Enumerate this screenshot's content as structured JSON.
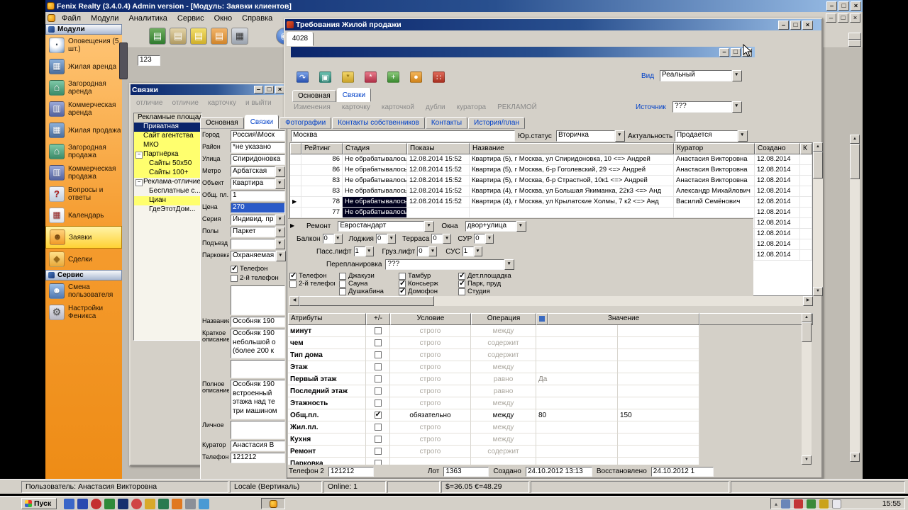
{
  "titlebar": {
    "title": "Fenix Realty (3.4.0.4) Admin version - [Модуль: Заявки клиентов]"
  },
  "menu": {
    "items": [
      "Файл",
      "Модули",
      "Аналитика",
      "Сервис",
      "Окно",
      "Справка"
    ]
  },
  "toolbar": {
    "field_value": "123"
  },
  "sidebar": {
    "modules_header": "Модули",
    "service_header": "Сервис",
    "module_items": [
      {
        "label": "Оповещения (5 шт.)",
        "icon": "clock"
      },
      {
        "label": "Жилая аренда",
        "icon": "building"
      },
      {
        "label": "Загородная аренда",
        "icon": "house"
      },
      {
        "label": "Коммерческая аренда",
        "icon": "tower"
      },
      {
        "label": "Жилая продажа",
        "icon": "building"
      },
      {
        "label": "Загородная продажа",
        "icon": "house"
      },
      {
        "label": "Коммерческая продажа",
        "icon": "tower"
      },
      {
        "label": "Вопросы и ответы",
        "icon": "question"
      },
      {
        "label": "Календарь",
        "icon": "calendar"
      },
      {
        "label": "Заявки",
        "icon": "people",
        "cls": "sel"
      },
      {
        "label": "Сделки",
        "icon": "deal"
      }
    ],
    "service_items": [
      {
        "label": "Смена пользователя",
        "icon": "user"
      },
      {
        "label": "Настройки Феникса",
        "icon": "gear"
      }
    ]
  },
  "svyazki": {
    "title": "Связки",
    "toolbar_labels": [
      "отличие",
      "отличие",
      "карточку",
      "и выйти"
    ],
    "tree_items": [
      {
        "label": "Рекламные площадки",
        "cls": "hdr"
      },
      {
        "label": "Приватная",
        "cls": "sel lvl1"
      },
      {
        "label": "Сайт агентства",
        "cls": "yel lvl1"
      },
      {
        "label": "МКО",
        "cls": "yel lvl1"
      },
      {
        "label": "Партнёрка",
        "cls": "yel lvl1 exp"
      },
      {
        "label": "Сайты 50х50",
        "cls": "yel lvl2"
      },
      {
        "label": "Сайты 100+",
        "cls": "yel lvl2"
      },
      {
        "label": "Реклама-отличие",
        "cls": "lvl1 exp"
      },
      {
        "label": "Бесплатные с...",
        "cls": "lvl2"
      },
      {
        "label": "Циан",
        "cls": "yel lvl2"
      },
      {
        "label": "ГдеЭтотДом...",
        "cls": "lvl2"
      }
    ]
  },
  "card": {
    "tabs": [
      {
        "label": "Основная",
        "cls": "plain"
      },
      {
        "label": "Связки",
        "cls": "sel"
      },
      {
        "label": "Фотографии"
      },
      {
        "label": "Контакты собственников"
      },
      {
        "label": "Контакты"
      },
      {
        "label": "История/план"
      }
    ],
    "fields": [
      {
        "label": "Город",
        "value": "Россия\\Моск"
      },
      {
        "label": "Район",
        "value": "*не указано"
      },
      {
        "label": "Улица",
        "value": "Спиридоновка"
      },
      {
        "label": "Метро",
        "value": "Арбатская",
        "cls": "combo"
      },
      {
        "label": "Объект",
        "value": "Квартира",
        "cls": "combo"
      },
      {
        "label": "Общ. пл.",
        "value": "1"
      },
      {
        "label": "Цена",
        "value": "270",
        "cls": "hl"
      },
      {
        "label": "Серия",
        "value": "Индивид. пр",
        "cls": "combo"
      },
      {
        "label": "Полы",
        "value": "Паркет",
        "cls": "combo"
      },
      {
        "label": "Подъезд",
        "value": "",
        "cls": "combo"
      },
      {
        "label": "Парковка",
        "value": "Охраняемая",
        "cls": "combo"
      }
    ],
    "checks": [
      {
        "label": "Телефон",
        "cls": "on"
      },
      {
        "label": "2-й телефон"
      }
    ],
    "fields2": [
      {
        "label": "",
        "value": "",
        "cls": "ml3"
      },
      {
        "label": "Название",
        "value": "Особняк 190"
      },
      {
        "label": "Краткое описание",
        "value": "Особняк 190\nнебольшой о\n(более 200 к",
        "cls": "ml3"
      },
      {
        "label": "",
        "value": "",
        "cls": "ml2"
      },
      {
        "label": "Полное описание",
        "value": "Особняк 190\nвстроенный\nэтажа над те\nтри машином",
        "cls": "ml4"
      },
      {
        "label": "Личное",
        "value": "",
        "cls": "ml2"
      },
      {
        "label": "Куратор",
        "value": "Анастасия В"
      },
      {
        "label": "Телефон",
        "value": "121212"
      }
    ]
  },
  "treb": {
    "title": "Требования Жилой продажи",
    "doc_tab": "4028",
    "vid_label": "Вид",
    "vid_value": "Реальный",
    "tabs": [
      {
        "label": "Основная",
        "cls": "plain"
      },
      {
        "label": "Связки",
        "cls": "sel"
      }
    ],
    "action_labels": [
      "Изменения",
      "карточку",
      "карточкой",
      "дубли",
      "куратора",
      "РЕКЛАМОЙ"
    ],
    "source_label": "Источник",
    "source_value": "???",
    "city": "Москва",
    "jur_label": "Юр.статус",
    "jur_value": "Вторичка",
    "act_label": "Актуальность",
    "act_value": "Продается",
    "table": {
      "columns": [
        "",
        "Рейтинг",
        "Стадия",
        "Показы",
        "Название",
        "Куратор",
        "Создано",
        "К"
      ],
      "rows": [
        {
          "rating": "86",
          "stage": "Не обрабатывалось",
          "shows": "12.08.2014 15:52",
          "name": "Квартира (5), г Москва, ул Спиридоновка, 10 <=> Андрей",
          "curator": "Анастасия Викторовна",
          "created": "12.08.2014"
        },
        {
          "rating": "86",
          "stage": "Не обрабатывалось",
          "shows": "12.08.2014 15:52",
          "name": "Квартира (5), г Москва, б-р Гоголевский, 29 <=> Андрей",
          "curator": "Анастасия Викторовна",
          "created": "12.08.2014"
        },
        {
          "rating": "83",
          "stage": "Не обрабатывалось",
          "shows": "12.08.2014 15:52",
          "name": "Квартира (5), г Москва, б-р Страстной, 10к1 <=> Андрей",
          "curator": "Анастасия Викторовна",
          "created": "12.08.2014"
        },
        {
          "rating": "83",
          "stage": "Не обрабатывалось",
          "shows": "12.08.2014 15:52",
          "name": "Квартира (4), г Москва, ул Большая Якиманка, 22к3 <=> Анд",
          "curator": "Александр Михайлович",
          "created": "12.08.2014"
        },
        {
          "rating": "78",
          "stage": "Не обрабатывалось",
          "shows": "12.08.2014 15:52",
          "name": "Квартира (4), г Москва, ул Крылатские Холмы, 7 к2 <=> Анд",
          "curator": "Василий Семёнович",
          "created": "12.08.2014",
          "cls": "sel mark"
        },
        {
          "rating": "77",
          "stage": "Не обрабатывалось",
          "shows": "",
          "name": "",
          "curator": "",
          "created": "12.08.2014",
          "cls": "sel"
        },
        {
          "created": "12.08.2014"
        },
        {
          "created": "12.08.2014"
        },
        {
          "created": "12.08.2014"
        },
        {
          "created": "12.08.2014"
        }
      ]
    },
    "form": {
      "remont_label": "Ремонт",
      "remont_value": "Евростандарт",
      "okna_label": "Окна",
      "okna_value": "двор+улица",
      "counters1": [
        {
          "label": "Балкон",
          "value": "0"
        },
        {
          "label": "Лоджия",
          "value": "0"
        },
        {
          "label": "Терраса",
          "value": "0"
        },
        {
          "label": "СУР",
          "value": "0"
        }
      ],
      "counters2": [
        {
          "label": "Пасс.лифт",
          "value": "1"
        },
        {
          "label": "Груз.лифт",
          "value": "0"
        },
        {
          "label": "СУС",
          "value": "1"
        }
      ],
      "pereplan_label": "Перепланировка",
      "pereplan_value": "???",
      "left_checks": [
        {
          "label": "Телефон",
          "cls": "on"
        },
        {
          "label": "2-й телефон"
        }
      ],
      "amenities": [
        {
          "label": "Джакузи"
        },
        {
          "label": "Тамбур"
        },
        {
          "label": "Дет.площадка",
          "cls": "on"
        },
        {
          "label": "Сауна"
        },
        {
          "label": "Консьерж",
          "cls": "on"
        },
        {
          "label": "Парк, пруд",
          "cls": "on"
        },
        {
          "label": "Душкабина"
        },
        {
          "label": "Домофон",
          "cls": "on"
        },
        {
          "label": "Студия"
        }
      ]
    },
    "attrs": {
      "columns": [
        "Атрибуты",
        "+/-",
        "Условие",
        "Операция",
        "Значение"
      ],
      "rows": [
        {
          "name": "минут",
          "cond": "строго",
          "op": "между"
        },
        {
          "name": "чем",
          "cond": "строго",
          "op": "содержит"
        },
        {
          "name": "Тип дома",
          "cond": "строго",
          "op": "содержит"
        },
        {
          "name": "Этаж",
          "cond": "строго",
          "op": "между"
        },
        {
          "name": "Первый этаж",
          "cond": "строго",
          "op": "равно",
          "val1": "Да"
        },
        {
          "name": "Последний этаж",
          "cond": "строго",
          "op": "равно"
        },
        {
          "name": "Этажность",
          "cond": "строго",
          "op": "между"
        },
        {
          "name": "Общ.пл.",
          "cond": "обязательно",
          "op": "между",
          "val1": "80",
          "val2": "150",
          "cls": "on"
        },
        {
          "name": "Жил.пл.",
          "cond": "строго",
          "op": "между"
        },
        {
          "name": "Кухня",
          "cond": "строго",
          "op": "между"
        },
        {
          "name": "Ремонт",
          "cond": "строго",
          "op": "содержит"
        },
        {
          "name": "Парковка"
        }
      ]
    },
    "bottom": {
      "phone2_label": "Телефон 2",
      "phone2_value": "121212",
      "lot_label": "Лот",
      "lot_value": "1363",
      "created_label": "Создано",
      "created_value": "24.10.2012 13:13",
      "restored_label": "Восстановлено",
      "restored_value": "24.10.2012 1"
    }
  },
  "statusbar": {
    "user": "Пользователь: Анастасия Викторовна",
    "locale": "Locale (Вертикаль)",
    "online": "Online: 1",
    "currency": "$=36.05 €=48.29"
  },
  "taskbar": {
    "start_label": "Пуск",
    "time": "15:55"
  }
}
